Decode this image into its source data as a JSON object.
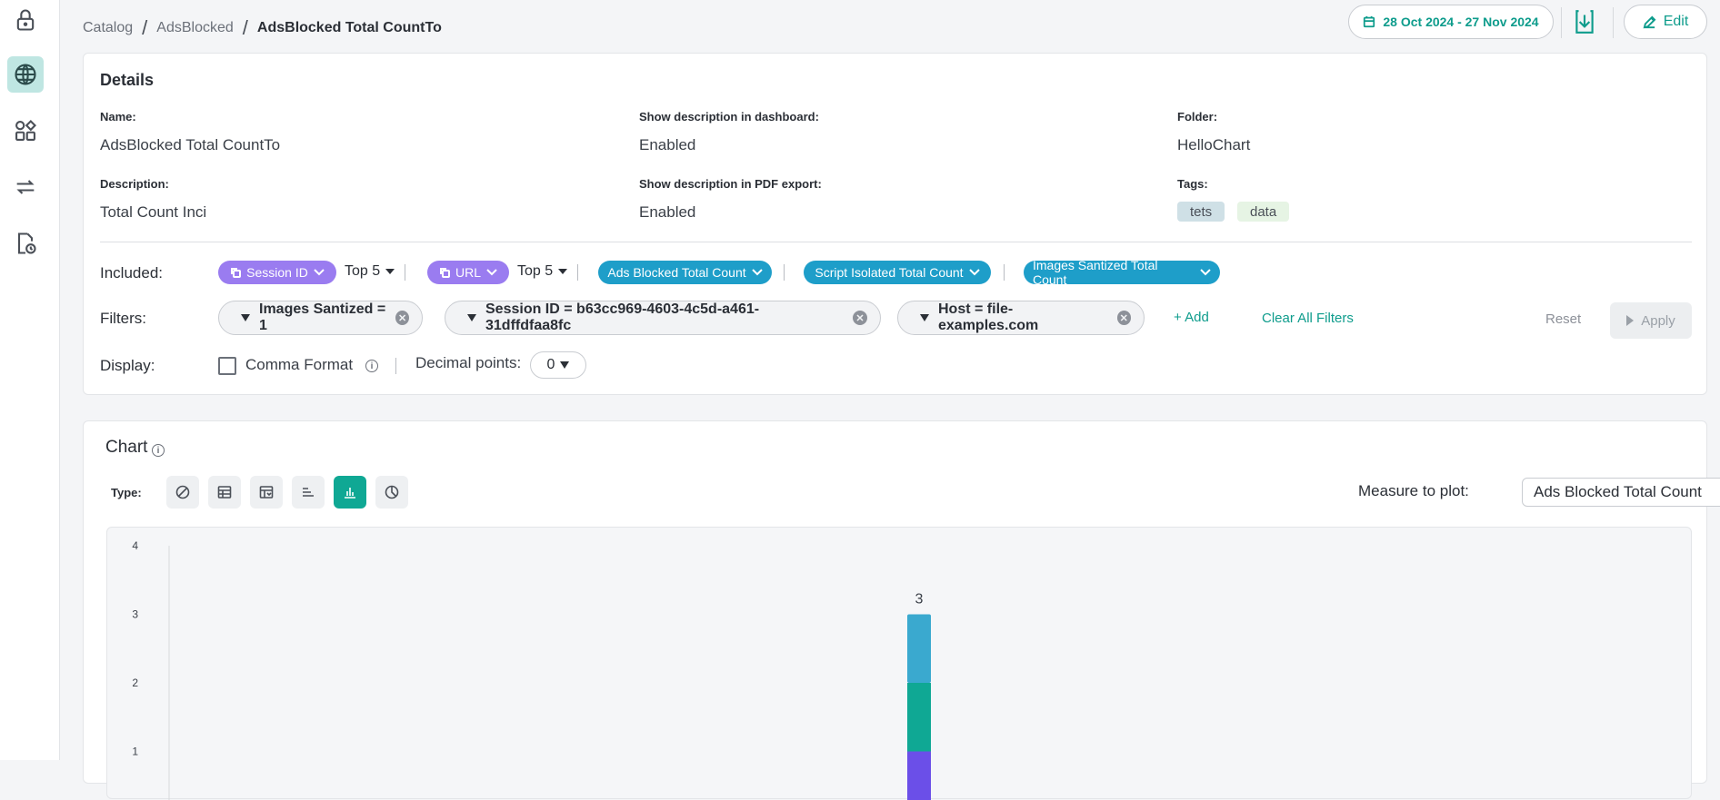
{
  "breadcrumb": {
    "items": [
      "Catalog",
      "AdsBlocked"
    ],
    "separator": "/",
    "current": "AdsBlocked Total CountTo"
  },
  "header": {
    "date_range": "28 Oct 2024 - 27 Nov 2024",
    "edit_label": "Edit"
  },
  "details": {
    "title": "Details",
    "name_label": "Name:",
    "name_value": "AdsBlocked Total CountTo",
    "desc_dash_label": "Show description in dashboard:",
    "desc_dash_value": "Enabled",
    "folder_label": "Folder:",
    "folder_value": "HelloChart",
    "description_label": "Description:",
    "description_value": "Total Count Inci",
    "desc_pdf_label": "Show description in PDF export:",
    "desc_pdf_value": "Enabled",
    "tags_label": "Tags:",
    "tags": [
      "tets",
      "data"
    ]
  },
  "included": {
    "label": "Included:",
    "dimensions": [
      {
        "label": "Session ID",
        "top": "Top 5"
      },
      {
        "label": "URL",
        "top": "Top 5"
      }
    ],
    "measures": [
      "Ads Blocked Total Count",
      "Script Isolated Total Count",
      "Images Santized Total Count"
    ]
  },
  "filters": {
    "label": "Filters:",
    "items": [
      "Images Santized = 1",
      "Session ID = b63cc969-4603-4c5d-a461-31dffdfaa8fc",
      "Host = file-examples.com"
    ],
    "add_label": "Add",
    "clear_label": "Clear All Filters",
    "reset_label": "Reset",
    "apply_label": "Apply"
  },
  "display": {
    "label": "Display:",
    "comma_label": "Comma Format",
    "decimal_label": "Decimal points:",
    "decimal_value": "0"
  },
  "chart_section": {
    "title": "Chart",
    "type_label": "Type:",
    "types": [
      "none",
      "table",
      "pivot-table",
      "horizontal-bar",
      "vertical-bar",
      "pie"
    ],
    "active_type": "vertical-bar",
    "measure_label": "Measure to plot:",
    "measure_value": "Ads Blocked Total Count"
  },
  "colors": {
    "accent": "#0e9c8c",
    "purple_pill": "#9a7cf0",
    "blue_pill": "#1e9ec9",
    "bar_segments": [
      "#6b4fe8",
      "#0fa894",
      "#3aa9cf"
    ]
  },
  "chart_data": {
    "type": "bar",
    "stacked": true,
    "ylim": [
      0,
      4
    ],
    "yticks": [
      1,
      2,
      3,
      4
    ],
    "total_label": "3",
    "series": [
      {
        "values": [
          1
        ]
      },
      {
        "values": [
          1
        ]
      },
      {
        "values": [
          1
        ]
      }
    ],
    "grid": false
  }
}
